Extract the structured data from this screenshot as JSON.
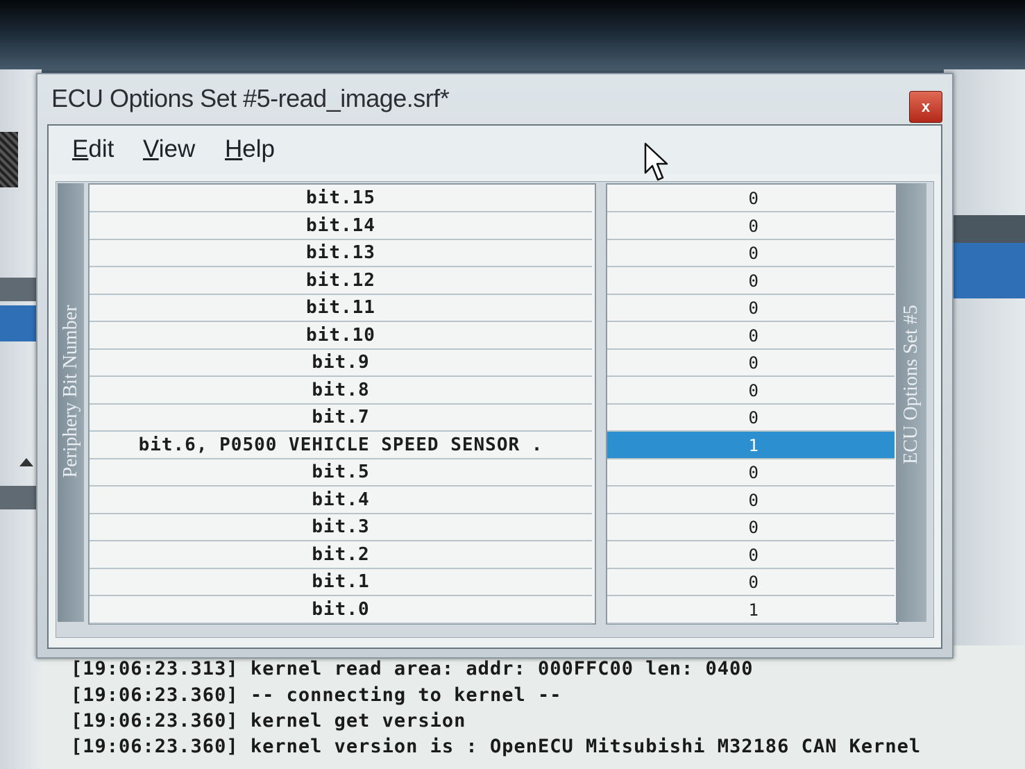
{
  "window": {
    "title": "ECU Options Set #5-read_image.srf*",
    "close_label": "x"
  },
  "menu": {
    "items": [
      {
        "label": "Edit"
      },
      {
        "label": "View"
      },
      {
        "label": "Help"
      }
    ]
  },
  "panel": {
    "left_caption": "Periphery Bit Number",
    "right_caption": "ECU Options Set #5"
  },
  "rows": [
    {
      "name": "bit.15",
      "value": "0"
    },
    {
      "name": "bit.14",
      "value": "0"
    },
    {
      "name": "bit.13",
      "value": "0"
    },
    {
      "name": "bit.12",
      "value": "0"
    },
    {
      "name": "bit.11",
      "value": "0"
    },
    {
      "name": "bit.10",
      "value": "0"
    },
    {
      "name": "bit.9",
      "value": "0"
    },
    {
      "name": "bit.8",
      "value": "0"
    },
    {
      "name": "bit.7",
      "value": "0"
    },
    {
      "name": "bit.6, P0500 VEHICLE SPEED SENSOR .",
      "value": "1",
      "selected": true
    },
    {
      "name": "bit.5",
      "value": "0"
    },
    {
      "name": "bit.4",
      "value": "0"
    },
    {
      "name": "bit.3",
      "value": "0"
    },
    {
      "name": "bit.2",
      "value": "0"
    },
    {
      "name": "bit.1",
      "value": "0"
    },
    {
      "name": "bit.0",
      "value": "1"
    }
  ],
  "log": [
    "[19:06:23.313] kernel read area: addr: 000FFC00 len: 0400",
    "[19:06:23.360] -- connecting to kernel --",
    "[19:06:23.360] kernel get version",
    "[19:06:23.360] kernel version is : OpenECU Mitsubishi M32186 CAN Kernel"
  ],
  "colors": {
    "selection": "#2b8fd0",
    "close_button": "#c0392b"
  }
}
